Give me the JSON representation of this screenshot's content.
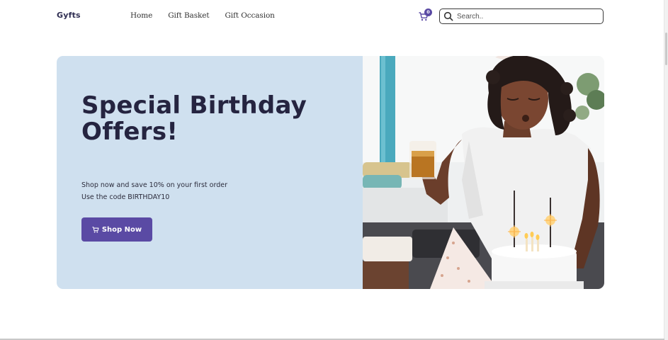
{
  "brand": {
    "name": "Gyfts",
    "accent": "#5a4aa4"
  },
  "nav": {
    "items": [
      {
        "label": "Home"
      },
      {
        "label": "Gift Basket"
      },
      {
        "label": "Gift Occasion"
      }
    ]
  },
  "cart": {
    "count": "0",
    "icon": "cart-icon"
  },
  "search": {
    "placeholder": "Search..",
    "value": "",
    "icon": "search-icon"
  },
  "hero": {
    "title": "Special Birthday Offers!",
    "line1": "Shop now and save 10% on your first order",
    "line2": "Use the code BIRTHDAY10",
    "button_label": "Shop Now",
    "button_icon": "cart-icon",
    "background": "#cfe0ef"
  }
}
